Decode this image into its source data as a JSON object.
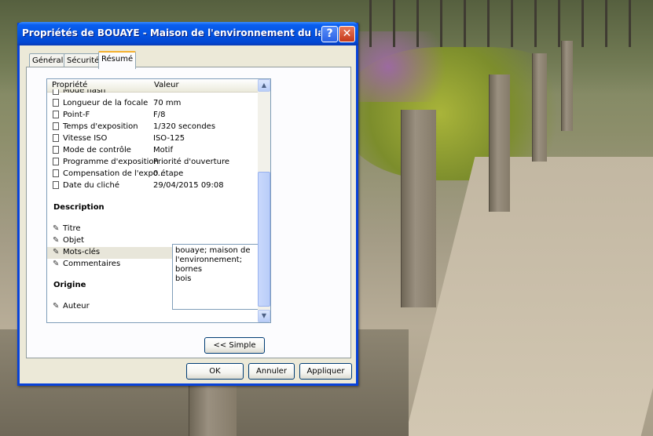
{
  "window": {
    "title": "Propriétés de BOUAYE - Maison de l'environnement du lac - born...",
    "help_label": "?",
    "close_label": "✕"
  },
  "tabs": [
    {
      "label": "Général",
      "active": false
    },
    {
      "label": "Sécurité",
      "active": false
    },
    {
      "label": "Résumé",
      "active": true
    }
  ],
  "list": {
    "col_property": "Propriété",
    "col_value": "Valeur",
    "rows": [
      {
        "key": "Mode flash",
        "value": ""
      },
      {
        "key": "Longueur de la focale",
        "value": "70 mm"
      },
      {
        "key": "Point-F",
        "value": "F/8"
      },
      {
        "key": "Temps d'exposition",
        "value": "1/320 secondes"
      },
      {
        "key": "Vitesse ISO",
        "value": "ISO-125"
      },
      {
        "key": "Mode de contrôle",
        "value": "Motif"
      },
      {
        "key": "Programme d'exposition",
        "value": "Priorité d'ouverture"
      },
      {
        "key": "Compensation de l'expo...",
        "value": "0 étape"
      },
      {
        "key": "Date du cliché",
        "value": "29/04/2015 09:08"
      }
    ],
    "section_description": "Description",
    "desc_rows": [
      {
        "key": "Titre"
      },
      {
        "key": "Objet"
      },
      {
        "key": "Mots-clés"
      },
      {
        "key": "Commentaires"
      }
    ],
    "section_origine": "Origine",
    "origin_rows": [
      {
        "key": "Auteur"
      }
    ],
    "keywords_value": "bouaye; maison de\nl'environnement; bornes\nbois"
  },
  "buttons": {
    "simple": "<< Simple",
    "ok": "OK",
    "cancel": "Annuler",
    "apply": "Appliquer"
  },
  "colors": {
    "titlebar": "#0454e2",
    "tab_accent": "#f5b12f",
    "dialog_bg": "#ece9d8"
  }
}
